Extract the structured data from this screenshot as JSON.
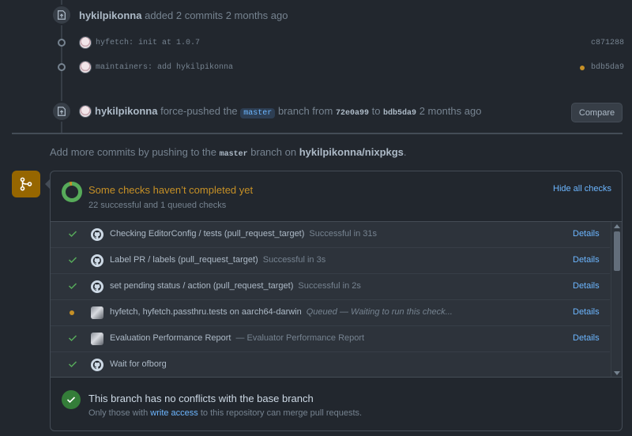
{
  "timeline": {
    "event1": {
      "user": "hykilpikonna",
      "action": "added 2 commits 2 months ago"
    },
    "commits": [
      {
        "message": "hyfetch: init at 1.0.7",
        "sha": "c871288"
      },
      {
        "message": "maintainers: add hykilpikonna",
        "sha": "bdb5da9"
      }
    ],
    "event2": {
      "user": "hykilpikonna",
      "action_pre": "force-pushed the",
      "branch": "master",
      "action_mid": "branch from",
      "from_sha": "72e0a99",
      "to_word": "to",
      "to_sha": "bdb5da9",
      "time": "2 months ago",
      "compare_label": "Compare"
    }
  },
  "hint": {
    "pre": "Add more commits by pushing to the",
    "branch": "master",
    "mid": "branch on",
    "repo": "hykilpikonna/nixpkgs",
    "end": "."
  },
  "checks": {
    "title": "Some checks haven’t completed yet",
    "subtitle": "22 successful and 1 queued checks",
    "hide_label": "Hide all checks",
    "items": [
      {
        "status": "success",
        "name": "Checking EditorConfig / tests (pull_request_target)",
        "desc": "Successful in 31s",
        "details": "Details",
        "icon": "github-icon"
      },
      {
        "status": "success",
        "name": "Label PR / labels (pull_request_target)",
        "desc": "Successful in 3s",
        "details": "Details",
        "icon": "github-icon"
      },
      {
        "status": "success",
        "name": "set pending status / action (pull_request_target)",
        "desc": "Successful in 2s",
        "details": "Details",
        "icon": "github-icon"
      },
      {
        "status": "queued",
        "name": "hyfetch, hyfetch.passthru.tests on aarch64-darwin",
        "desc": "Queued — Waiting to run this check...",
        "details": "Details",
        "icon": "app-avatar-icon"
      },
      {
        "status": "success",
        "name": "Evaluation Performance Report",
        "desc": "— Evaluator Performance Report",
        "details": "Details",
        "icon": "app-avatar-icon"
      },
      {
        "status": "success",
        "name": "Wait for ofborg",
        "desc": "",
        "details": "",
        "icon": "github-icon"
      }
    ]
  },
  "merge": {
    "title": "This branch has no conflicts with the base branch",
    "sub_pre": "Only those with",
    "sub_link": "write access",
    "sub_post": "to this repository can merge pull requests."
  },
  "colors": {
    "background": "#22272e",
    "success": "#57ab5a",
    "pending": "#c69026",
    "link": "#6cb6ff"
  }
}
